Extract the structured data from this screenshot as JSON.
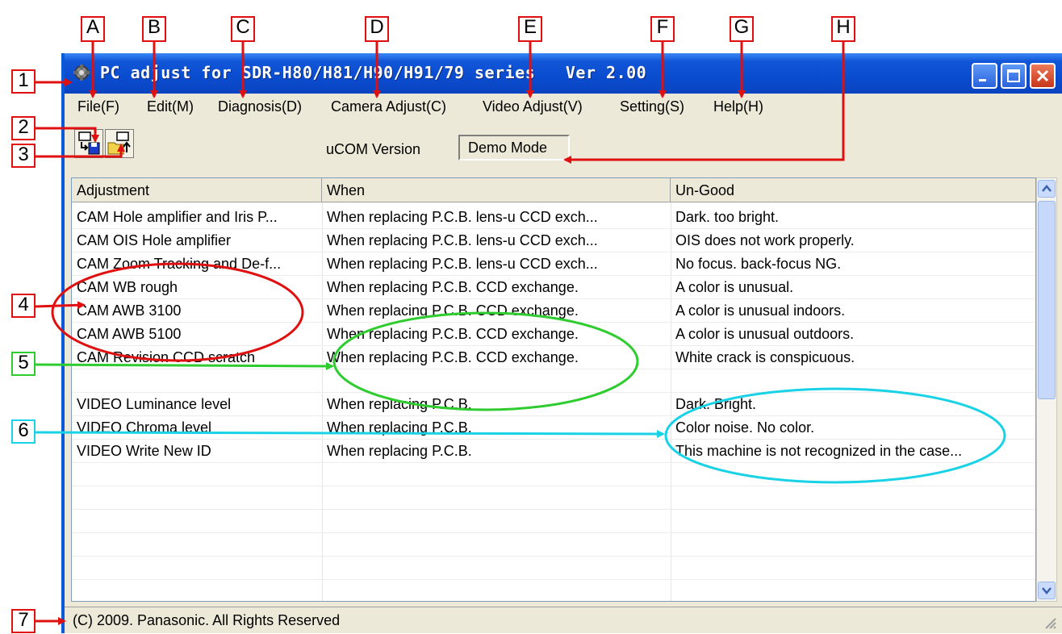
{
  "callout_letters": [
    "A",
    "B",
    "C",
    "D",
    "E",
    "F",
    "G",
    "H"
  ],
  "callout_numbers": [
    "1",
    "2",
    "3",
    "4",
    "5",
    "6",
    "7"
  ],
  "window": {
    "title": "PC adjust for SDR-H80/H81/H90/H91/79 series   Ver 2.00"
  },
  "menu": [
    "File(F)",
    "Edit(M)",
    "Diagnosis(D)",
    "Camera Adjust(C)",
    "Video Adjust(V)",
    "Setting(S)",
    "Help(H)"
  ],
  "toolbar": {
    "ucom_label": "uCOM Version",
    "ucom_value": "Demo Mode"
  },
  "table": {
    "columns": [
      "Adjustment",
      "When",
      "Un-Good"
    ],
    "rows": [
      [
        "CAM Hole amplifier and Iris P...",
        "When replacing P.C.B. lens-u CCD exch...",
        "Dark. too bright."
      ],
      [
        "CAM OIS Hole amplifier",
        "When replacing P.C.B. lens-u CCD exch...",
        "OIS does not work properly."
      ],
      [
        "CAM Zoom Tracking and De-f...",
        "When replacing P.C.B. lens-u CCD exch...",
        "No focus. back-focus NG."
      ],
      [
        "CAM WB rough",
        "When replacing P.C.B. CCD exchange.",
        "A color is unusual."
      ],
      [
        "CAM AWB 3100",
        "When replacing P.C.B. CCD exchange.",
        "A color is unusual indoors."
      ],
      [
        "CAM AWB 5100",
        "When replacing P.C.B. CCD exchange.",
        "A color is unusual outdoors."
      ],
      [
        "CAM Revision CCD scratch",
        "When replacing P.C.B. CCD exchange.",
        "White crack is conspicuous."
      ],
      [
        "",
        "",
        ""
      ],
      [
        "VIDEO Luminance level",
        "When replacing P.C.B.",
        "Dark. Bright."
      ],
      [
        "VIDEO Chroma level",
        "When replacing P.C.B.",
        "Color noise. No color."
      ],
      [
        "VIDEO Write New ID",
        "When replacing P.C.B.",
        "This machine is not recognized in the case..."
      ]
    ]
  },
  "status": "(C) 2009. Panasonic. All Rights Reserved",
  "colors": {
    "callout_red": "#e01010",
    "callout_green": "#2ecc2e",
    "callout_cyan": "#1ad2e6",
    "title_blue": "#0a4ccf"
  }
}
